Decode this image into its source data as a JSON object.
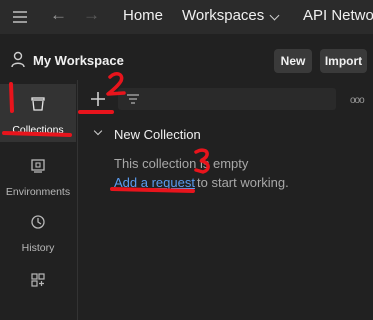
{
  "topbar": {
    "home_label": "Home",
    "workspaces_label": "Workspaces",
    "api_network_label": "API Netwo"
  },
  "workspace": {
    "title": "My Workspace",
    "new_label": "New",
    "import_label": "Import"
  },
  "sidebar": {
    "items": [
      {
        "label": "Collections",
        "icon": "collections-icon",
        "active": true
      },
      {
        "label": "Environments",
        "icon": "environments-icon"
      },
      {
        "label": "History",
        "icon": "history-icon"
      },
      {
        "label": "",
        "icon": "apps-icon"
      }
    ]
  },
  "collection": {
    "name": "New Collection",
    "empty_text": "This collection is empty",
    "add_link": "Add a request",
    "after_link": " to start working."
  },
  "annotations": {
    "color": "#e8141c",
    "labels": [
      "2",
      "3"
    ]
  }
}
